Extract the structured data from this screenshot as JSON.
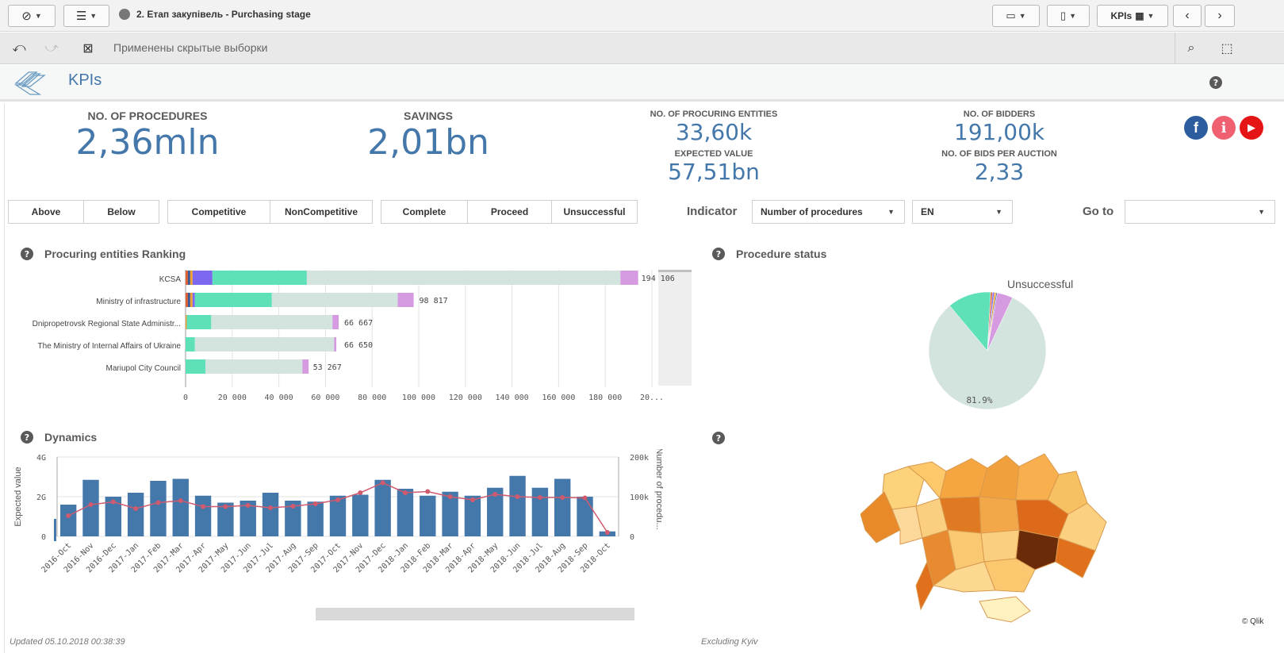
{
  "toolbar": {
    "sheet_title": "2. Етап закупівель - Purchasing stage",
    "sheet_name_btn": "KPIs"
  },
  "selections": {
    "text": "Применены скрытые выборки"
  },
  "sheet": {
    "title": "KPIs"
  },
  "kpis": {
    "procedures_title": "NO. OF PROCEDURES",
    "procedures_value": "2,36mln",
    "savings_title": "SAVINGS",
    "savings_value": "2,01bn",
    "entities_title": "NO. OF PROCURING ENTITIES",
    "entities_value": "33,60k",
    "expected_title": "EXPECTED VALUE",
    "expected_value": "57,51bn",
    "bidders_title": "NO. OF BIDDERS",
    "bidders_value": "191,00k",
    "bids_title": "NO. OF BIDS PER AUCTION",
    "bids_value": "2,33"
  },
  "filters": {
    "above": "Above",
    "below": "Below",
    "competitive": "Competitive",
    "noncompetitive": "NonCompetitive",
    "complete": "Complete",
    "proceed": "Proceed",
    "unsuccessful": "Unsuccessful",
    "indicator_label": "Indicator",
    "indicator_value": "Number of procedures",
    "language_value": "EN",
    "goto_label": "Go to",
    "goto_value": ""
  },
  "panels": {
    "ranking_title": "Procuring entities Ranking",
    "status_title": "Procedure status",
    "dynamics_title": "Dynamics"
  },
  "colors": {
    "accent": "#4477aa",
    "teal": "#5ee0b8",
    "grey_bar": "#d3e3dd",
    "pink": "#d59ae0",
    "purple": "#7b68ee",
    "bar_blue": "#4477aa",
    "line_red": "#d05a6e"
  },
  "chart_data": [
    {
      "type": "bar",
      "orientation": "horizontal",
      "stacked": true,
      "categories": [
        "KCSA",
        "Ministry of infrastructure",
        "Dnipropetrovsk Regional State Administr...",
        "The Ministry of Internal Affairs of Ukraine",
        "Mariupol City Council"
      ],
      "totals": [
        194106,
        98817,
        66667,
        66650,
        53267
      ],
      "total_labels": [
        "194 106",
        "98 817",
        "66 667",
        "66 650",
        "53 267"
      ],
      "segments": [
        {
          "values": [
            1000,
            1000,
            0,
            0,
            0
          ],
          "color": "#e06030"
        },
        {
          "values": [
            1000,
            1000,
            0,
            0,
            0
          ],
          "color": "#3a5a9a"
        },
        {
          "values": [
            1000,
            1000,
            500,
            0,
            0
          ],
          "color": "#f0a030"
        },
        {
          "values": [
            8500,
            1000,
            0,
            0,
            0
          ],
          "color": "#7b68ee"
        },
        {
          "values": [
            40500,
            33000,
            10500,
            4000,
            8500
          ],
          "color": "#5ee0b8"
        },
        {
          "values": [
            134500,
            54000,
            52000,
            59700,
            41600
          ],
          "color": "#d3e3dd"
        },
        {
          "values": [
            7606,
            6817,
            2667,
            950,
            2667
          ],
          "color": "#d59ae0"
        }
      ],
      "x_ticks": [
        "0",
        "20 000",
        "40 000",
        "60 000",
        "80 000",
        "100 000",
        "120 000",
        "140 000",
        "160 000",
        "180 000",
        "20..."
      ],
      "xlim": [
        0,
        200000
      ]
    },
    {
      "type": "pie",
      "labels": [
        "Unsuccessful"
      ],
      "slice_label": "81.9%",
      "slices": [
        {
          "value": 81.9,
          "color": "#d3e3dd"
        },
        {
          "value": 12.0,
          "color": "#5ee0b8"
        },
        {
          "value": 0.5,
          "color": "#e06030"
        },
        {
          "value": 0.5,
          "color": "#7b68ee"
        },
        {
          "value": 0.5,
          "color": "#f0a030"
        },
        {
          "value": 0.3,
          "color": "#3a5a9a"
        },
        {
          "value": 4.3,
          "color": "#d59ae0"
        }
      ]
    },
    {
      "type": "bar+line",
      "categories": [
        "2016-Oct",
        "2016-Nov",
        "2016-Dec",
        "2017-Jan",
        "2017-Feb",
        "2017-Mar",
        "2017-Apr",
        "2017-May",
        "2017-Jun",
        "2017-Jul",
        "2017-Aug",
        "2017-Sep",
        "2017-Oct",
        "2017-Nov",
        "2017-Dec",
        "2018-Jan",
        "2018-Feb",
        "2018-Mar",
        "2018-Apr",
        "2018-May",
        "2018-Jun",
        "2018-Jul",
        "2018-Aug",
        "2018-Sep",
        "2018-Oct"
      ],
      "bars_label": "Expected value",
      "bars": [
        1.6,
        2.85,
        2.0,
        2.2,
        2.8,
        2.9,
        2.05,
        1.7,
        1.8,
        2.2,
        1.8,
        1.75,
        2.05,
        2.1,
        2.85,
        2.4,
        2.05,
        2.25,
        2.05,
        2.45,
        3.05,
        2.45,
        2.9,
        2.0,
        0.25
      ],
      "line_label": "Number of procedu...",
      "line": [
        52000,
        80000,
        87000,
        70000,
        85000,
        90000,
        75000,
        75000,
        78000,
        72000,
        76000,
        82000,
        92000,
        110000,
        135000,
        110000,
        113000,
        100000,
        92000,
        106000,
        100000,
        98000,
        98000,
        97000,
        10000
      ],
      "y_left_ticks": [
        "0",
        "2G",
        "4G"
      ],
      "y_right_ticks": [
        "0",
        "100k",
        "200k"
      ],
      "ylim_left": [
        0,
        4
      ],
      "ylim_right": [
        0,
        200000
      ]
    }
  ],
  "map": {
    "copyright": "© Qlik"
  },
  "footer": {
    "updated": "Updated 05.10.2018 00:38:39",
    "excluding": "Excluding Kyiv"
  }
}
